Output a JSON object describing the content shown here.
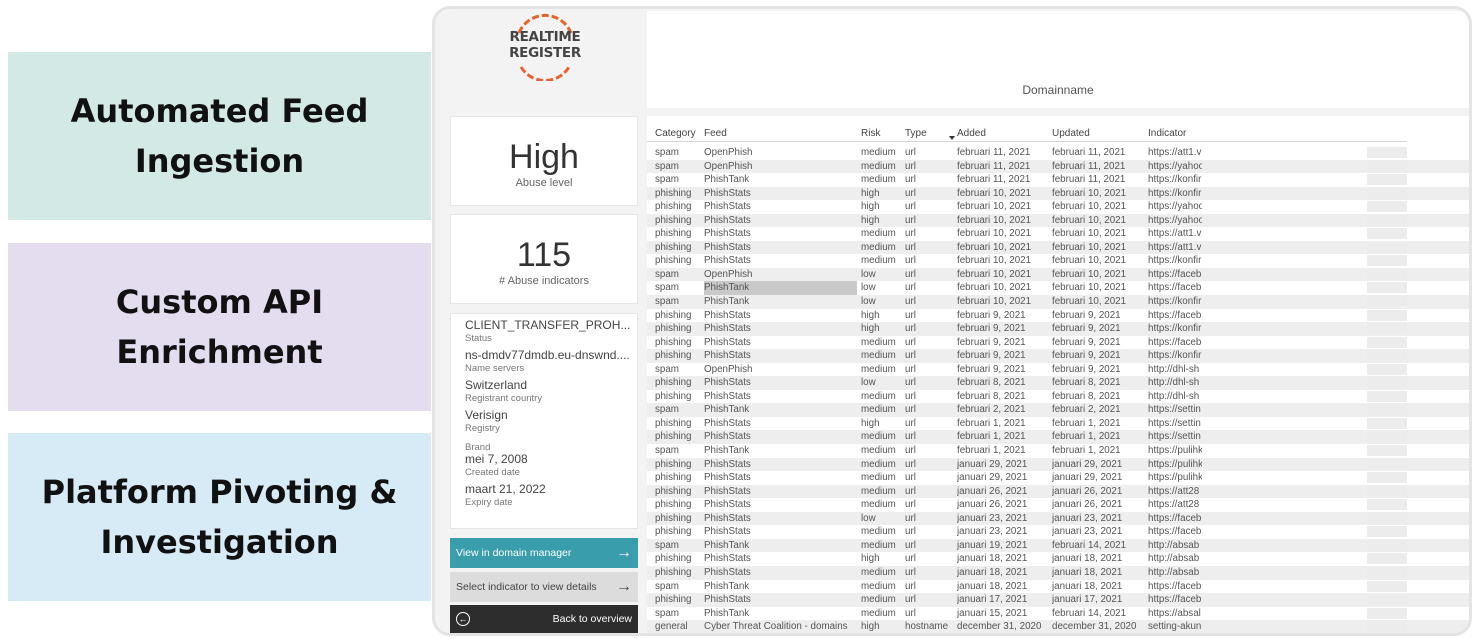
{
  "features": [
    {
      "line1": "Automated Feed",
      "line2": "Ingestion",
      "color": "#d3e9e5"
    },
    {
      "line1": "Custom API",
      "line2": "Enrichment",
      "color": "#e4dcef"
    },
    {
      "line1": "Platform Pivoting &",
      "line2": "Investigation",
      "color": "#d6ebf6"
    }
  ],
  "logo": {
    "line1": "REALTIME",
    "line2": "REGISTER",
    "accent": "#e8632b"
  },
  "header": {
    "label": "Domainname"
  },
  "abuse": {
    "value": "High",
    "label": "Abuse level"
  },
  "count": {
    "value": "115",
    "label": "# Abuse indicators"
  },
  "info": [
    {
      "value": "CLIENT_TRANSFER_PROH...",
      "label": "Status"
    },
    {
      "value": "ns-dmdv77dmdb.eu-dnswnd....",
      "label": "Name servers"
    },
    {
      "value": "Switzerland",
      "label": "Registrant country"
    },
    {
      "value": "Verisign",
      "label": "Registry"
    },
    {
      "value": "",
      "label": "Brand"
    },
    {
      "value": "mei 7, 2008",
      "label": "Created date"
    },
    {
      "value": "maart 21, 2022",
      "label": "Expiry date"
    }
  ],
  "buttons": {
    "domain_manager": "View in domain manager",
    "select_indicator": "Select indicator to view details",
    "back": "Back to overview"
  },
  "table": {
    "columns": [
      "Category",
      "Feed",
      "Risk",
      "Type",
      "Added",
      "Updated",
      "Indicator"
    ],
    "rows": [
      [
        "spam",
        "OpenPhish",
        "medium",
        "url",
        "februari 11, 2021",
        "februari 11, 2021",
        "https://att1.v"
      ],
      [
        "spam",
        "OpenPhish",
        "medium",
        "url",
        "februari 11, 2021",
        "februari 11, 2021",
        "https://yahoo"
      ],
      [
        "spam",
        "PhishTank",
        "medium",
        "url",
        "februari 11, 2021",
        "februari 11, 2021",
        "https://konfir"
      ],
      [
        "phishing",
        "PhishStats",
        "high",
        "url",
        "februari 10, 2021",
        "februari 10, 2021",
        "https://konfir"
      ],
      [
        "phishing",
        "PhishStats",
        "high",
        "url",
        "februari 10, 2021",
        "februari 10, 2021",
        "https://yahoo"
      ],
      [
        "phishing",
        "PhishStats",
        "high",
        "url",
        "februari 10, 2021",
        "februari 10, 2021",
        "https://yahoo"
      ],
      [
        "phishing",
        "PhishStats",
        "medium",
        "url",
        "februari 10, 2021",
        "februari 10, 2021",
        "https://att1.v"
      ],
      [
        "phishing",
        "PhishStats",
        "medium",
        "url",
        "februari 10, 2021",
        "februari 10, 2021",
        "https://att1.v"
      ],
      [
        "phishing",
        "PhishStats",
        "medium",
        "url",
        "februari 10, 2021",
        "februari 10, 2021",
        "https://konfir"
      ],
      [
        "spam",
        "OpenPhish",
        "low",
        "url",
        "februari 10, 2021",
        "februari 10, 2021",
        "https://faceb"
      ],
      [
        "spam",
        "PhishTank",
        "low",
        "url",
        "februari 10, 2021",
        "februari 10, 2021",
        "https://faceb"
      ],
      [
        "spam",
        "PhishTank",
        "low",
        "url",
        "februari 10, 2021",
        "februari 10, 2021",
        "https://konfir"
      ],
      [
        "phishing",
        "PhishStats",
        "high",
        "url",
        "februari 9, 2021",
        "februari 9, 2021",
        "https://faceb"
      ],
      [
        "phishing",
        "PhishStats",
        "high",
        "url",
        "februari 9, 2021",
        "februari 9, 2021",
        "https://konfir"
      ],
      [
        "phishing",
        "PhishStats",
        "medium",
        "url",
        "februari 9, 2021",
        "februari 9, 2021",
        "https://faceb"
      ],
      [
        "phishing",
        "PhishStats",
        "medium",
        "url",
        "februari 9, 2021",
        "februari 9, 2021",
        "https://konfir"
      ],
      [
        "spam",
        "OpenPhish",
        "medium",
        "url",
        "februari 9, 2021",
        "februari 9, 2021",
        "http://dhl-sh"
      ],
      [
        "phishing",
        "PhishStats",
        "low",
        "url",
        "februari 8, 2021",
        "februari 8, 2021",
        "http://dhl-sh"
      ],
      [
        "phishing",
        "PhishStats",
        "medium",
        "url",
        "februari 8, 2021",
        "februari 8, 2021",
        "http://dhl-sh"
      ],
      [
        "spam",
        "PhishTank",
        "medium",
        "url",
        "februari 2, 2021",
        "februari 2, 2021",
        "https://settin"
      ],
      [
        "phishing",
        "PhishStats",
        "high",
        "url",
        "februari 1, 2021",
        "februari 1, 2021",
        "https://settin"
      ],
      [
        "phishing",
        "PhishStats",
        "medium",
        "url",
        "februari 1, 2021",
        "februari 1, 2021",
        "https://settin"
      ],
      [
        "spam",
        "PhishTank",
        "medium",
        "url",
        "februari 1, 2021",
        "februari 1, 2021",
        "https://pulihk"
      ],
      [
        "phishing",
        "PhishStats",
        "medium",
        "url",
        "januari 29, 2021",
        "januari 29, 2021",
        "https://pulihk"
      ],
      [
        "phishing",
        "PhishStats",
        "medium",
        "url",
        "januari 29, 2021",
        "januari 29, 2021",
        "https://pulihk"
      ],
      [
        "phishing",
        "PhishStats",
        "medium",
        "url",
        "januari 26, 2021",
        "januari 26, 2021",
        "https://att28"
      ],
      [
        "phishing",
        "PhishStats",
        "medium",
        "url",
        "januari 26, 2021",
        "januari 26, 2021",
        "https://att28"
      ],
      [
        "phishing",
        "PhishStats",
        "low",
        "url",
        "januari 23, 2021",
        "januari 23, 2021",
        "https://faceb"
      ],
      [
        "phishing",
        "PhishStats",
        "medium",
        "url",
        "januari 23, 2021",
        "januari 23, 2021",
        "https://faceb"
      ],
      [
        "spam",
        "PhishTank",
        "medium",
        "url",
        "januari 19, 2021",
        "februari 14, 2021",
        "http://absab"
      ],
      [
        "phishing",
        "PhishStats",
        "high",
        "url",
        "januari 18, 2021",
        "januari 18, 2021",
        "http://absab"
      ],
      [
        "phishing",
        "PhishStats",
        "medium",
        "url",
        "januari 18, 2021",
        "januari 18, 2021",
        "http://absab"
      ],
      [
        "spam",
        "PhishTank",
        "medium",
        "url",
        "januari 18, 2021",
        "januari 18, 2021",
        "https://faceb"
      ],
      [
        "phishing",
        "PhishStats",
        "medium",
        "url",
        "januari 17, 2021",
        "januari 17, 2021",
        "https://faceb"
      ],
      [
        "spam",
        "PhishTank",
        "medium",
        "url",
        "januari 15, 2021",
        "februari 14, 2021",
        "https://absal"
      ],
      [
        "general",
        "Cyber Threat Coalition - domains",
        "high",
        "hostname",
        "december 31, 2020",
        "december 31, 2020",
        "setting-akun"
      ]
    ],
    "highlighted_row": 10
  }
}
